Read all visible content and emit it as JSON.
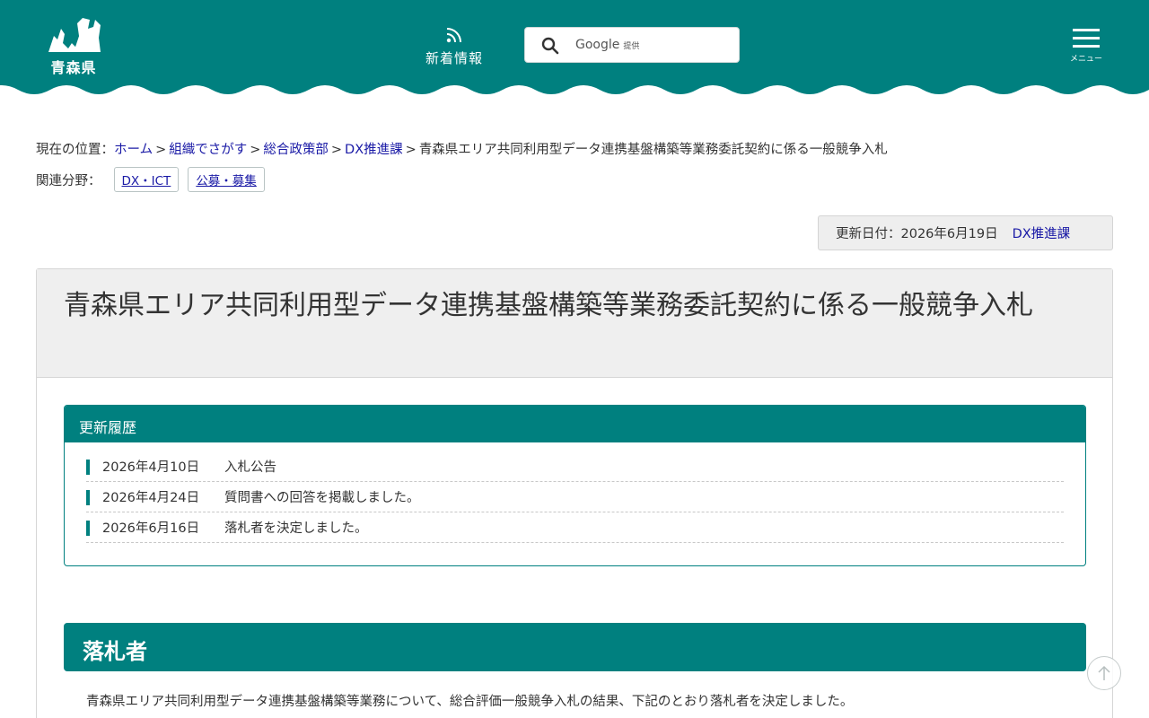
{
  "header": {
    "logo_text": "青森県",
    "news_label": "新着情報",
    "search": {
      "brand": "Google",
      "brand_suffix": "提供"
    },
    "menu_label": "メニュー",
    "color": "#00807f"
  },
  "breadcrumb": {
    "prefix": "現在の位置：",
    "items": [
      "ホーム",
      "組織でさがす",
      "総合政策部",
      "DX推進課"
    ],
    "current": "青森県エリア共同利用型データ連携基盤構築等業務委託契約に係る一般競争入札"
  },
  "related": {
    "label": "関連分野：",
    "tags": [
      "DX・ICT",
      "公募・募集"
    ]
  },
  "updated": {
    "text": "更新日付：2026年6月19日",
    "dept": "DX推進課"
  },
  "page_title": "青森県エリア共同利用型データ連携基盤構築等業務委託契約に係る一般競争入札",
  "history": {
    "heading": "更新履歴",
    "items": [
      {
        "date": "2026年4月10日",
        "text": "入札公告"
      },
      {
        "date": "2026年4月24日",
        "text": "質問書への回答を掲載しました。"
      },
      {
        "date": "2026年6月16日",
        "text": "落札者を決定しました。"
      }
    ]
  },
  "section": {
    "heading": "落札者",
    "body": "青森県エリア共同利用型データ連携基盤構築等業務について、総合評価一般競争入札の結果、下記のとおり落札者を決定しました。"
  },
  "icons": {
    "news": "rss-icon",
    "search": "search-icon",
    "menu": "hamburger-icon",
    "top": "arrow-up-icon"
  }
}
